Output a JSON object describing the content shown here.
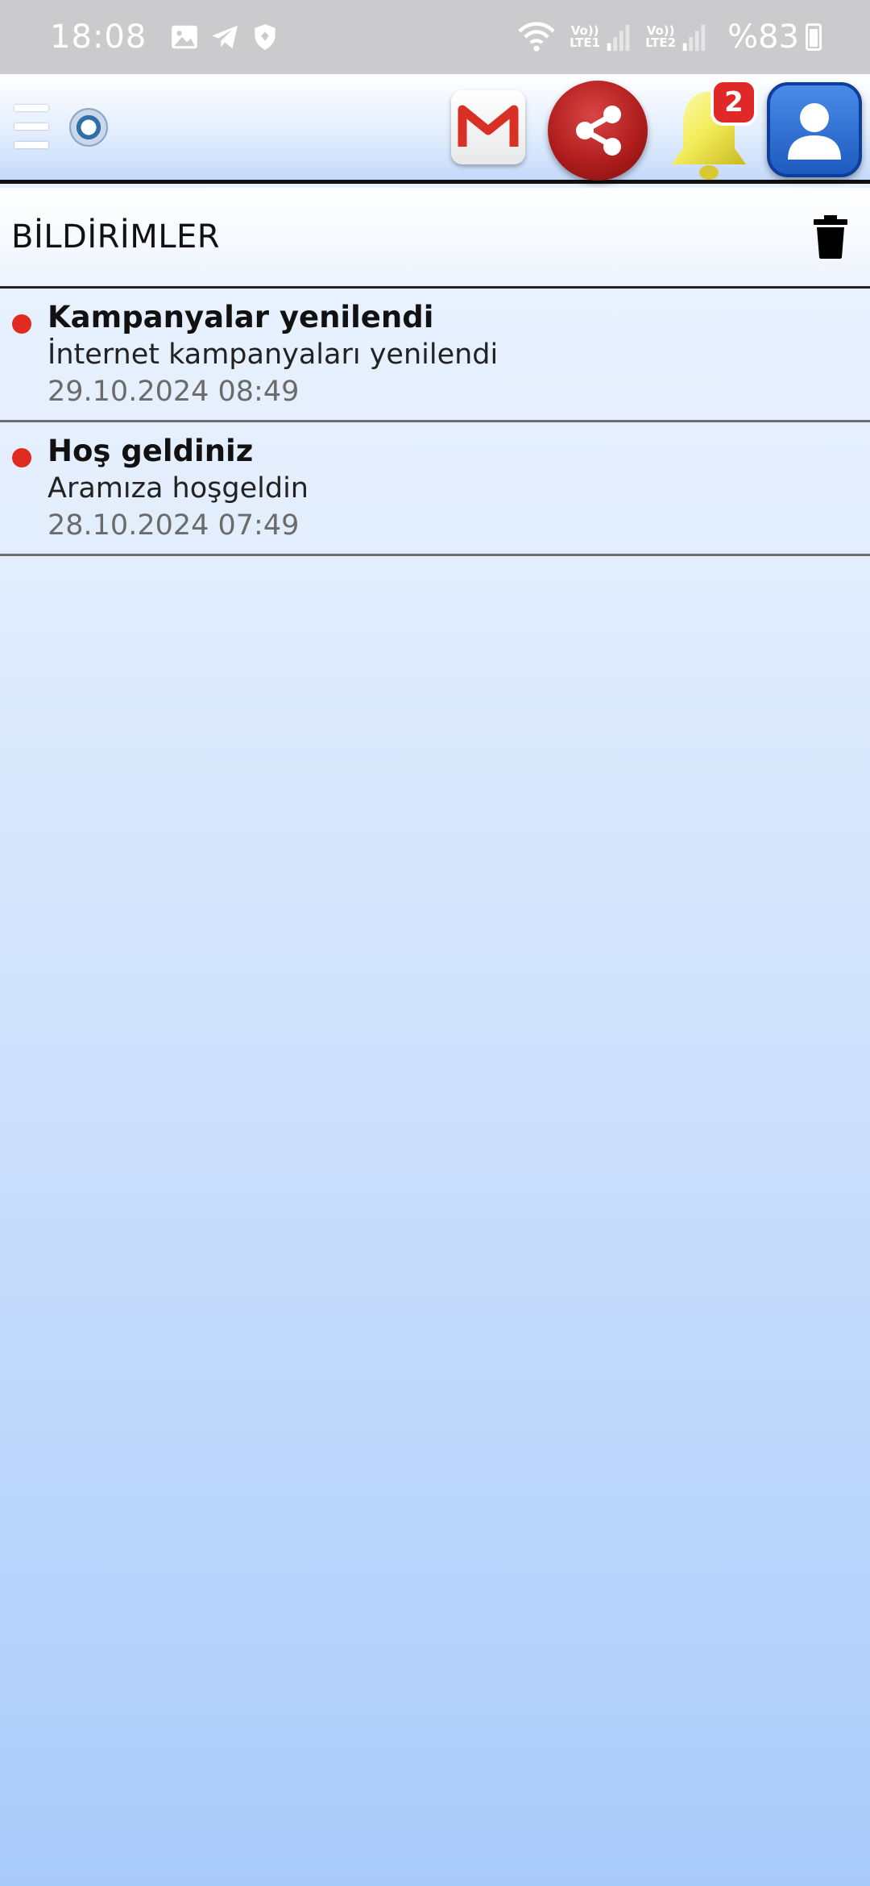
{
  "status_bar": {
    "time": "18:08",
    "sim1": "LTE1",
    "sim2": "LTE2",
    "volte": "Vo))",
    "battery": "%83"
  },
  "header": {
    "badge_count": "2",
    "icons": [
      "menu-icon",
      "logo",
      "gmail-icon",
      "share-icon",
      "bell-icon",
      "profile-icon"
    ]
  },
  "page": {
    "title": "BİLDİRİMLER"
  },
  "notifications": [
    {
      "title": "Kampanyalar yenilendi",
      "body": "İnternet kampanyaları yenilendi",
      "date": "29.10.2024 08:49"
    },
    {
      "title": "Hoş geldiniz",
      "body": "Aramıza hoşgeldin",
      "date": "28.10.2024 07:49"
    }
  ],
  "colors": {
    "unread_dot": "#e02b20",
    "share_red": "#b11e1e",
    "profile_blue": "#1d5bc0",
    "bell_yellow": "#f2ec5a"
  }
}
